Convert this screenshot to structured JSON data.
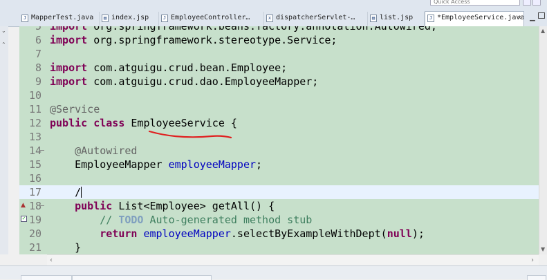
{
  "tabs": [
    {
      "label": "MapperTest.java",
      "icon": "java-file-icon"
    },
    {
      "label": "index.jsp",
      "icon": "jsp-file-icon"
    },
    {
      "label": "EmployeeController…",
      "icon": "java-file-icon"
    },
    {
      "label": "dispatcherServlet-…",
      "icon": "xml-file-icon"
    },
    {
      "label": "list.jsp",
      "icon": "jsp-file-icon"
    },
    {
      "label": "*EmployeeService.java",
      "icon": "java-file-icon",
      "active": true
    }
  ],
  "quick_access": "Quick Access",
  "editor": {
    "lines": [
      {
        "n": "5",
        "tokens": [
          {
            "t": "import",
            "c": "kw"
          },
          {
            "t": " org.springframework.beans.factory.annotation.Autowired;"
          }
        ]
      },
      {
        "n": "6",
        "tokens": [
          {
            "t": "import",
            "c": "kw"
          },
          {
            "t": " org.springframework.stereotype.Service;"
          }
        ]
      },
      {
        "n": "7",
        "tokens": []
      },
      {
        "n": "8",
        "tokens": [
          {
            "t": "import",
            "c": "kw"
          },
          {
            "t": " com.atguigu.crud.bean.Employee;"
          }
        ]
      },
      {
        "n": "9",
        "tokens": [
          {
            "t": "import",
            "c": "kw"
          },
          {
            "t": " com.atguigu.crud.dao.EmployeeMapper;"
          }
        ]
      },
      {
        "n": "10",
        "tokens": []
      },
      {
        "n": "11",
        "tokens": [
          {
            "t": "@Service",
            "c": "ann"
          }
        ]
      },
      {
        "n": "12",
        "tokens": [
          {
            "t": "public",
            "c": "kw"
          },
          {
            "t": " "
          },
          {
            "t": "class",
            "c": "kw"
          },
          {
            "t": " EmployeeService {"
          }
        ]
      },
      {
        "n": "13",
        "tokens": []
      },
      {
        "n": "14",
        "fold": true,
        "tokens": [
          {
            "t": "    "
          },
          {
            "t": "@Autowired",
            "c": "ann"
          }
        ]
      },
      {
        "n": "15",
        "tokens": [
          {
            "t": "    EmployeeMapper "
          },
          {
            "t": "employeeMapper",
            "c": "fld"
          },
          {
            "t": ";"
          }
        ]
      },
      {
        "n": "16",
        "tokens": []
      },
      {
        "n": "17",
        "current": true,
        "caret": true,
        "tokens": [
          {
            "t": "    /"
          }
        ]
      },
      {
        "n": "18",
        "fold": true,
        "marker": "override",
        "tokens": [
          {
            "t": "    "
          },
          {
            "t": "public",
            "c": "kw"
          },
          {
            "t": " List<Employee> getAll() {"
          }
        ]
      },
      {
        "n": "19",
        "marker": "task",
        "tokens": [
          {
            "t": "        "
          },
          {
            "t": "// ",
            "c": "cmt"
          },
          {
            "t": "TODO",
            "c": "todo"
          },
          {
            "t": " Auto-generated method stub",
            "c": "cmt"
          }
        ]
      },
      {
        "n": "20",
        "tokens": [
          {
            "t": "        "
          },
          {
            "t": "return",
            "c": "kw"
          },
          {
            "t": " "
          },
          {
            "t": "employeeMapper",
            "c": "fld"
          },
          {
            "t": ".selectByExampleWithDept("
          },
          {
            "t": "null",
            "c": "kw"
          },
          {
            "t": ");"
          }
        ]
      },
      {
        "n": "21",
        "tokens": [
          {
            "t": "    }"
          }
        ]
      }
    ]
  },
  "colors": {
    "editor_bg": "#c7e0cb",
    "current_line": "#e8f2fe",
    "keyword": "#7f0055",
    "annotation_mark": "#e02020"
  }
}
